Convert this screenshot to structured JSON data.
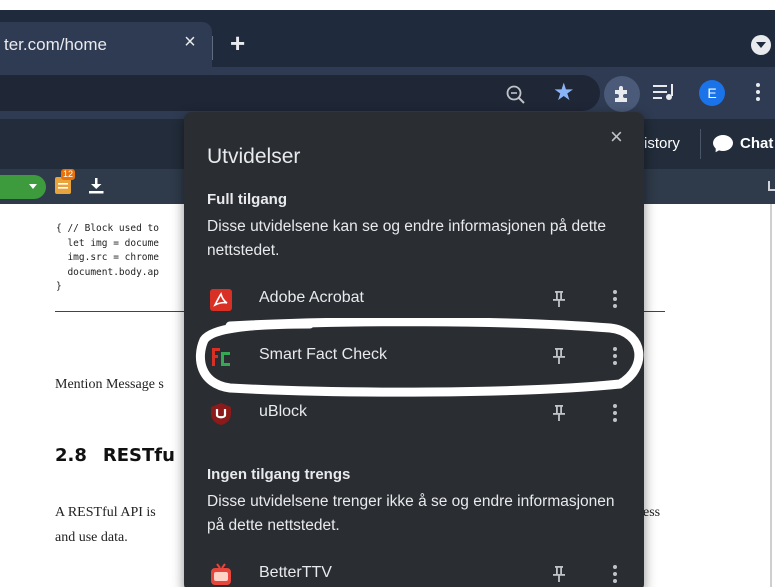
{
  "browser": {
    "tab": {
      "title": "ter.com/home",
      "close": "×"
    },
    "new_tab": "+",
    "profile_initial": "E",
    "icons": [
      "zoom-icon",
      "star-icon",
      "extensions-icon",
      "media-control-icon",
      "more-menu-icon"
    ]
  },
  "app": {
    "history_label": "istory",
    "chat_label": "Chat",
    "badge_count": "12"
  },
  "document": {
    "code_lines": [
      "{ // Block used to",
      "  let img = docume",
      "  img.src = chrome",
      "  document.body.ap",
      "}"
    ],
    "para_mention": "Mention Message s",
    "section_number": "2.8",
    "section_title": "RESTfu",
    "para_restful": "A RESTful API is",
    "para_restful_right": "ess",
    "para_use_data": "and use data."
  },
  "extensions_popup": {
    "title": "Utvidelser",
    "close": "×",
    "full_access": {
      "heading": "Full tilgang",
      "description": "Disse utvidelsene kan se og endre informasjonen på dette nettstedet.",
      "items": [
        {
          "name": "Adobe Acrobat",
          "icon": "adobe-acrobat-icon"
        },
        {
          "name": "Smart Fact Check",
          "icon": "smart-fact-check-icon"
        },
        {
          "name": "uBlock",
          "icon": "ublock-icon"
        }
      ]
    },
    "no_access": {
      "heading": "Ingen tilgang trengs",
      "description": "Disse utvidelsene trenger ikke å se og endre informasjonen på dette nettstedet.",
      "items": [
        {
          "name": "BetterTTV",
          "icon": "betterttv-icon"
        }
      ]
    }
  },
  "colors": {
    "popup_bg": "#2a2d31",
    "tabbar_bg": "#1f2a3d",
    "accent_blue": "#8ab4f8",
    "adobe_red": "#d93025",
    "ublock_red": "#8b1a1a"
  }
}
